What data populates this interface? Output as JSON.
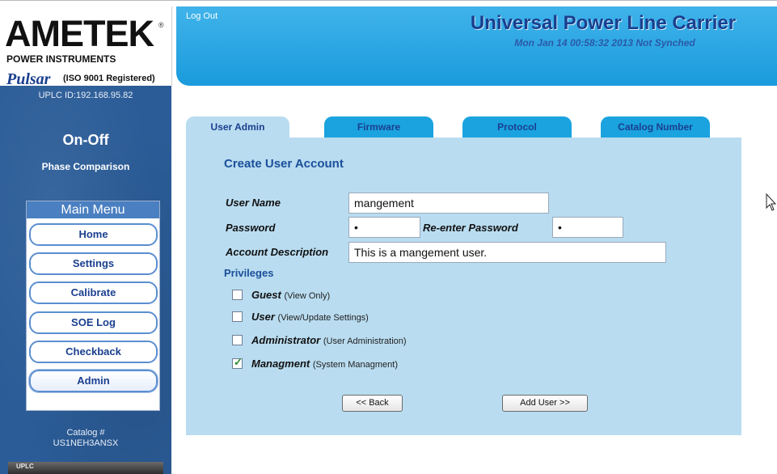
{
  "brand": {
    "company": "AMETEK",
    "registered": "®",
    "division": "POWER INSTRUMENTS",
    "product_brand": "Pulsar",
    "iso": "(ISO 9001 Registered)"
  },
  "sidebar": {
    "uplc_id": "UPLC ID:192.168.95.82",
    "mode": "On-Off",
    "mode_sub": "Phase Comparison",
    "menu_title": "Main Menu",
    "menu_items": [
      {
        "label": "Home"
      },
      {
        "label": "Settings"
      },
      {
        "label": "Calibrate"
      },
      {
        "label": "SOE Log"
      },
      {
        "label": "Checkback"
      },
      {
        "label": "Admin"
      }
    ],
    "catalog_label": "Catalog #",
    "catalog_value": "US1NEH3ANSX",
    "device_text": "UPLC"
  },
  "header": {
    "logout": "Log Out",
    "title": "Universal Power Line Carrier",
    "datetime": "Mon Jan 14 00:58:32 2013 Not Synched"
  },
  "tabs": [
    {
      "label": "User Admin",
      "active": true
    },
    {
      "label": "Firmware",
      "active": false
    },
    {
      "label": "Protocol",
      "active": false
    },
    {
      "label": "Catalog Number",
      "active": false
    }
  ],
  "form": {
    "title": "Create User Account",
    "user_name_label": "User Name",
    "user_name_value": "mangement",
    "password_label": "Password",
    "password_value": "•",
    "reenter_label": "Re-enter Password",
    "reenter_value": "•",
    "description_label": "Account Description",
    "description_value": "This is a mangement user.",
    "privileges_title": "Privileges",
    "privileges": [
      {
        "name": "Guest",
        "desc": "(View Only)",
        "checked": false
      },
      {
        "name": "User",
        "desc": "(View/Update Settings)",
        "checked": false
      },
      {
        "name": "Administrator",
        "desc": "(User Administration)",
        "checked": false
      },
      {
        "name": "Managment",
        "desc": "(System Managment)",
        "checked": true
      }
    ],
    "back_button": "<< Back",
    "add_button": "Add User >>"
  },
  "colors": {
    "sidebar_bg": "#2b5c97",
    "header_bg": "#1ea0e0",
    "panel_bg": "#b9dcf0",
    "title_blue": "#1a3f8f"
  }
}
